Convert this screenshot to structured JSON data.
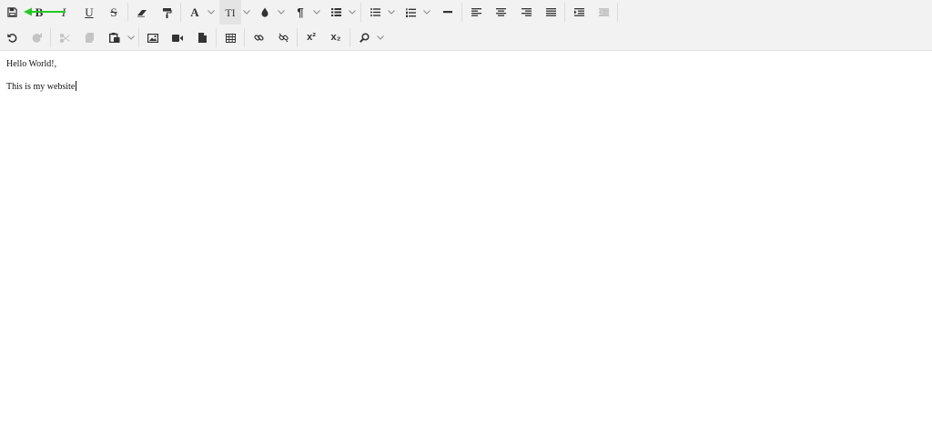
{
  "toolbar": {
    "row1": [
      {
        "id": "save",
        "icon": "save-icon",
        "glyph": ""
      },
      {
        "id": "bold",
        "icon": "bold-icon",
        "glyph": "B"
      },
      {
        "id": "italic",
        "icon": "italic-icon",
        "glyph": "I"
      },
      {
        "id": "underline",
        "icon": "underline-icon",
        "glyph": "U"
      },
      {
        "id": "strikethrough",
        "icon": "strikethrough-icon",
        "glyph": "S"
      },
      {
        "id": "eraser",
        "icon": "eraser-icon",
        "glyph": ""
      },
      {
        "id": "format-paint",
        "icon": "paint-roller-icon",
        "glyph": ""
      },
      {
        "id": "font-family",
        "icon": "font-icon",
        "glyph": "A"
      },
      {
        "id": "font-size",
        "icon": "text-height-icon",
        "glyph": "TI"
      },
      {
        "id": "color",
        "icon": "color-drop-icon",
        "glyph": ""
      },
      {
        "id": "paragraph",
        "icon": "pilcrow-icon",
        "glyph": "¶"
      },
      {
        "id": "paragraph-format",
        "icon": "list-format-icon",
        "glyph": ""
      },
      {
        "id": "unordered-list",
        "icon": "bullet-list-icon",
        "glyph": ""
      },
      {
        "id": "ordered-list",
        "icon": "numbered-list-icon",
        "glyph": ""
      },
      {
        "id": "horizontal-line",
        "icon": "horizontal-line-icon",
        "glyph": ""
      },
      {
        "id": "align-left",
        "icon": "align-left-icon",
        "glyph": ""
      },
      {
        "id": "align-center",
        "icon": "align-center-icon",
        "glyph": ""
      },
      {
        "id": "align-right",
        "icon": "align-right-icon",
        "glyph": ""
      },
      {
        "id": "align-justify",
        "icon": "align-justify-icon",
        "glyph": ""
      },
      {
        "id": "indent",
        "icon": "indent-icon",
        "glyph": ""
      },
      {
        "id": "outdent",
        "icon": "outdent-icon",
        "glyph": ""
      }
    ],
    "row2": [
      {
        "id": "undo",
        "icon": "undo-icon",
        "glyph": ""
      },
      {
        "id": "redo",
        "icon": "redo-icon",
        "glyph": ""
      },
      {
        "id": "cut",
        "icon": "scissors-icon",
        "glyph": ""
      },
      {
        "id": "copy",
        "icon": "copy-icon",
        "glyph": ""
      },
      {
        "id": "paste",
        "icon": "paste-icon",
        "glyph": ""
      },
      {
        "id": "image",
        "icon": "image-icon",
        "glyph": ""
      },
      {
        "id": "video",
        "icon": "video-icon",
        "glyph": ""
      },
      {
        "id": "file",
        "icon": "file-icon",
        "glyph": ""
      },
      {
        "id": "table",
        "icon": "table-icon",
        "glyph": ""
      },
      {
        "id": "link",
        "icon": "link-icon",
        "glyph": ""
      },
      {
        "id": "unlink",
        "icon": "unlink-icon",
        "glyph": ""
      },
      {
        "id": "superscript",
        "icon": "superscript-icon",
        "glyph": "x²"
      },
      {
        "id": "subscript",
        "icon": "subscript-icon",
        "glyph": "x₂"
      },
      {
        "id": "find",
        "icon": "search-icon",
        "glyph": ""
      }
    ]
  },
  "editor": {
    "paragraphs": [
      "Hello World!,",
      "This is my website"
    ]
  },
  "colors": {
    "toolbar_bg": "#f2f2f2",
    "icon": "#333333",
    "disabled_icon": "#c4c4c4",
    "annotation_arrow": "#22cc22"
  }
}
